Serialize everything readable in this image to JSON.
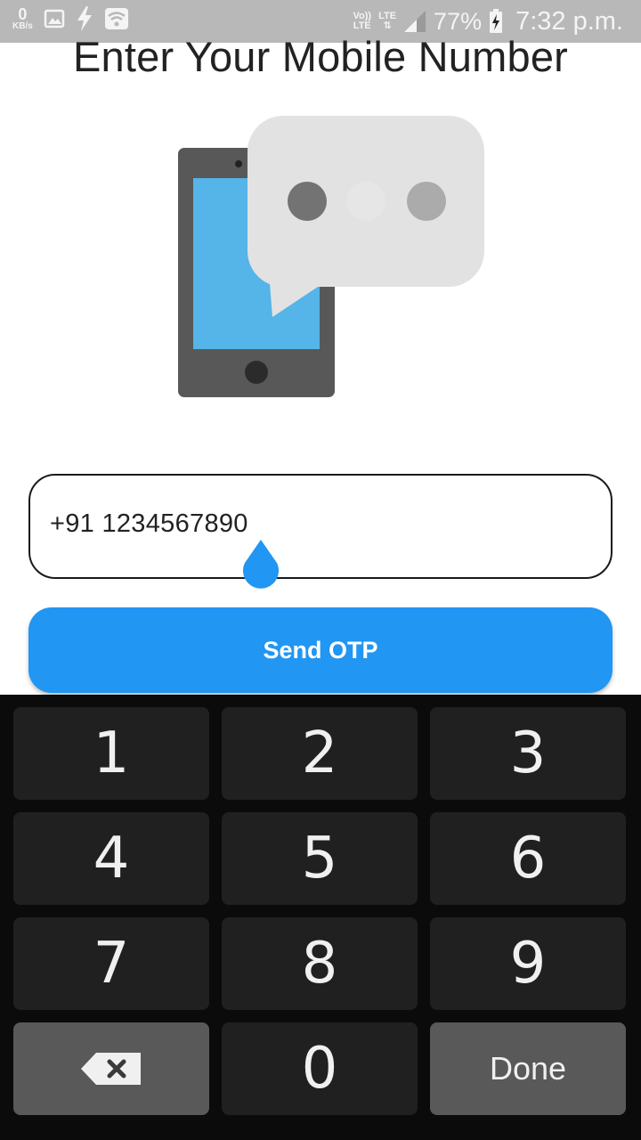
{
  "status_bar": {
    "speed_value": "0",
    "speed_unit": "KB/s",
    "volte_top": "Vo))",
    "volte_bottom": "LTE",
    "network_label": "LTE",
    "battery_percent": "77%",
    "time": "7:32 p.m.",
    "icons": [
      "image-icon",
      "flash-icon",
      "wifi-icon",
      "signal-icon",
      "battery-charging-icon"
    ]
  },
  "title": "Enter Your Mobile Number",
  "illustration": {
    "icon": "phone-chat-illustration",
    "colors": {
      "phone_body": "#585858",
      "screen": "#55b4e8",
      "bubble": "#e2e2e2",
      "dot_dark": "#737373",
      "dot_light": "#ababab"
    }
  },
  "phone_input": {
    "value": "+91 1234567890"
  },
  "send_button": {
    "label": "Send OTP",
    "color": "#2196f3"
  },
  "keypad": {
    "keys": [
      "1",
      "2",
      "3",
      "4",
      "5",
      "6",
      "7",
      "8",
      "9",
      "",
      "0",
      "Done"
    ],
    "backspace_icon": "backspace-icon"
  }
}
